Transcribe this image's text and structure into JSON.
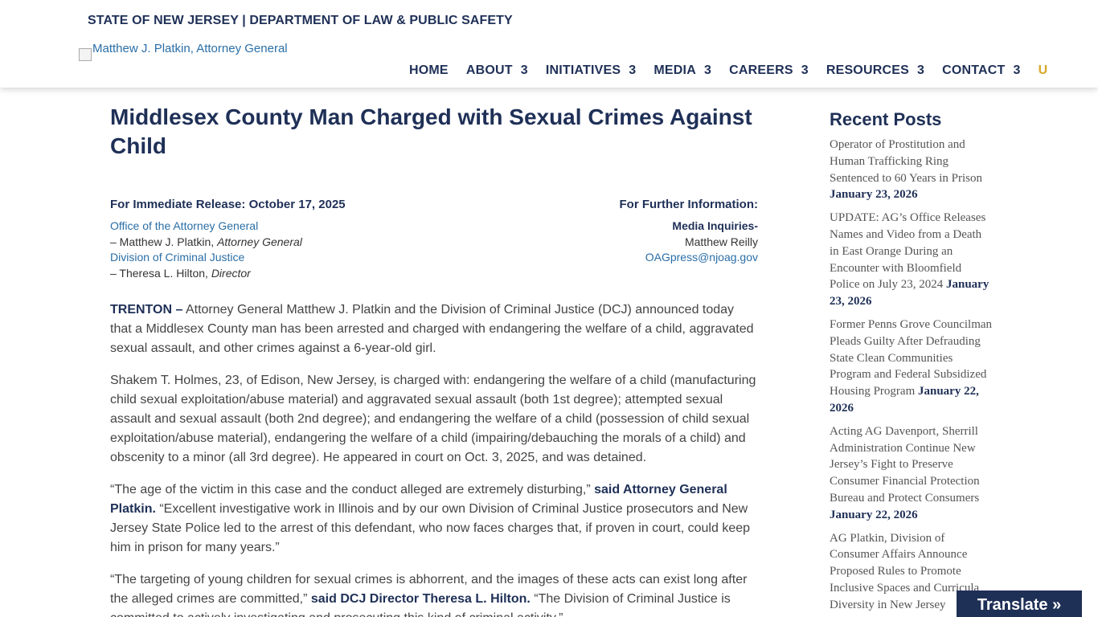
{
  "header": {
    "agency": "STATE OF NEW JERSEY | DEPARTMENT OF LAW & PUBLIC SAFETY",
    "social_icons": [
      "",
      "",
      "",
      "",
      "",
      ""
    ],
    "logo_alt": "Matthew J. Platkin, Attorney General",
    "nav": [
      {
        "label": "HOME",
        "arrow": ""
      },
      {
        "label": "ABOUT",
        "arrow": "3"
      },
      {
        "label": "INITIATIVES",
        "arrow": "3"
      },
      {
        "label": "MEDIA",
        "arrow": "3"
      },
      {
        "label": "CAREERS",
        "arrow": "3"
      },
      {
        "label": "RESOURCES",
        "arrow": "3"
      },
      {
        "label": "CONTACT",
        "arrow": "3"
      }
    ],
    "search_glyph": "U"
  },
  "article": {
    "title": "Middlesex County Man Charged with Sexual Crimes Against Child",
    "release_header": "For Immediate Release: October 17, 2025",
    "office": "Office of the Attorney General",
    "ag_name": "– Matthew J. Platkin, ",
    "ag_title": "Attorney General",
    "division": "Division of Criminal Justice",
    "director_name": "– Theresa L. Hilton, ",
    "director_title": "Director",
    "info_header": "For Further Information:",
    "media_inquiries": "Media Inquiries-",
    "media_contact": "Matthew Reilly",
    "media_email": "OAGpress@njoag.gov",
    "p1_lead": "TRENTON –",
    "p1": " Attorney General Matthew J. Platkin and the Division of Criminal Justice (DCJ) announced today that a Middlesex County man has been arrested and charged with endangering the welfare of a child, aggravated sexual assault, and other crimes against a 6-year-old girl.",
    "p2": "Shakem T. Holmes, 23, of Edison, New Jersey, is charged with: endangering the welfare of a child (manufacturing child sexual exploitation/abuse material) and aggravated sexual assault (both 1st degree); attempted sexual assault and sexual assault (both 2nd degree); and endangering the welfare of a child (possession of child sexual exploitation/abuse material), endangering the welfare of a child (impairing/debauching the morals of a child) and obscenity to a minor (all 3rd degree). He appeared in court on Oct. 3, 2025, and was detained.",
    "p3_a": "“The age of the victim in this case and the conduct alleged are extremely disturbing,” ",
    "p3_b": "said Attorney General Platkin.",
    "p3_c": " “Excellent investigative work in Illinois and by our own Division of Criminal Justice prosecutors and New Jersey State Police led to the arrest of this defendant, who now faces charges that, if proven in court, could keep him in prison for many years.”",
    "p4_a": "“The targeting of young children for sexual crimes is abhorrent, and the images of these acts can exist long after the alleged crimes are committed,” ",
    "p4_b": "said DCJ Director Theresa L. Hilton.",
    "p4_c": " “The Division of Criminal Justice is committed to actively investigating and prosecuting this kind of criminal activity.”"
  },
  "sidebar": {
    "heading": "Recent Posts",
    "posts": [
      {
        "title": "Operator of Prostitution and Human Trafficking Ring Sentenced to 60 Years in Prison",
        "date": "January 23, 2026"
      },
      {
        "title": "UPDATE: AG’s Office Releases Names and Video from a Death in East Orange During an Encounter with Bloomfield Police on July 23, 2024",
        "date": "January 23, 2026"
      },
      {
        "title": "Former Penns Grove Councilman Pleads Guilty After Defrauding State Clean Communities Program and Federal Subsidized Housing Program",
        "date": "January 22, 2026"
      },
      {
        "title": "Acting AG Davenport, Sherrill Administration Continue New Jersey’s Fight to Preserve Consumer Financial Protection Bureau and Protect Consumers",
        "date": "January 22, 2026"
      },
      {
        "title": "AG Platkin, Division of Consumer Affairs Announce Proposed Rules to Promote Inclusive Spaces and Curricula Diversity in New Jersey",
        "date": ""
      }
    ]
  },
  "translate": "Translate »"
}
